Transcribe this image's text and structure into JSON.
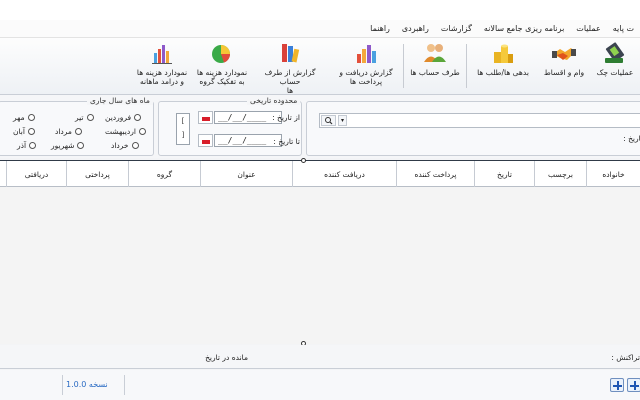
{
  "menu": [
    "ت پایه",
    "عملیات",
    "برنامه ریزی جامع سالانه",
    "گزارشات",
    "راهبردی",
    "راهنما"
  ],
  "toolbar": {
    "cheque_ops": "عملیات چک",
    "loans": "وام و اقساط",
    "debts": "بدهی ها/طلب ها",
    "accounts": [
      "طرف حساب ها"
    ],
    "rec_pay_report": [
      "گزارش دریافت و",
      "پرداخت ها"
    ],
    "party_report": [
      "گزارش از طرف حساب",
      "ها"
    ],
    "group_chart": [
      "نمودارد هزینه ها",
      "به تفکیک گروه"
    ],
    "monthly_chart": [
      "نمودارد هزینه ها",
      "و درامد ماهانه"
    ]
  },
  "months": {
    "title": "ماه های سال جاری",
    "items": [
      "فروردین",
      "تیر",
      "مهر",
      "اردیبهشت",
      "مرداد",
      "آبان",
      "خرداد",
      "شهریور",
      "آذر"
    ]
  },
  "date_range": {
    "title": "محدوده تاریخی",
    "from_label": "از تاریخ :",
    "to_label": "تا تاریخ :",
    "from_value": "__/__/____",
    "to_value": "__/__/____"
  },
  "search": {
    "date_label": "تاریخ :"
  },
  "grid": {
    "columns": [
      "خانواده",
      "برچسب",
      "تاریخ",
      "پرداخت کننده",
      "دریافت کننده",
      "عنوان",
      "گروه",
      "پرداختی",
      "دریافتی"
    ]
  },
  "summary": {
    "tx_label": "تراکنش :",
    "balance_label": "مانده در تاریخ"
  },
  "status": {
    "version": "نسخه 1.0.0"
  }
}
